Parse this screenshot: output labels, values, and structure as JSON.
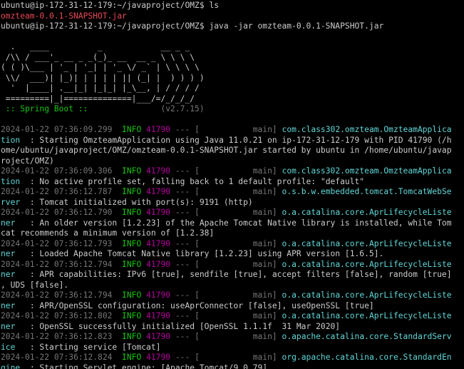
{
  "terminal": {
    "lines": [
      [
        {
          "t": "ubuntu@ip-172-31-12-179:~/javaproject/OMZ$ ls",
          "c": "white"
        }
      ],
      [
        {
          "t": "omzteam-0.0.1-SNAPSHOT.jar",
          "c": "red"
        }
      ],
      [
        {
          "t": "ubuntu@ip-172-31-12-179:~/javaproject/OMZ$ java -jar omzteam-0.0.1-SNAPSHOT.jar",
          "c": "white"
        }
      ],
      [
        {
          "t": "",
          "c": "white"
        }
      ],
      [
        {
          "t": "  .   ____          _            __ _ _",
          "c": "white"
        }
      ],
      [
        {
          "t": " /\\\\ / ___'_ __ _ _(_)_ __  __ _ \\ \\ \\ \\",
          "c": "white"
        }
      ],
      [
        {
          "t": "( ( )\\___ | '_ | '_| | '_ \\/ _` | \\ \\ \\ \\",
          "c": "white"
        }
      ],
      [
        {
          "t": " \\\\/  ___)| |_)| | | | | || (_| |  ) ) ) )",
          "c": "white"
        }
      ],
      [
        {
          "t": "  '  |____| .__|_| |_|_| |_\\__, | / / / /",
          "c": "white"
        }
      ],
      [
        {
          "t": " =========|_|==============|___/=/_/_/_/",
          "c": "white"
        }
      ],
      [
        {
          "t": " :: Spring Boot :: ",
          "c": "green"
        },
        {
          "t": "              (v2.7.15)",
          "c": "gray"
        }
      ],
      [
        {
          "t": "",
          "c": "white"
        }
      ],
      [
        {
          "t": "2024-01-22 07:36:09.299  ",
          "c": "gray"
        },
        {
          "t": "INFO ",
          "c": "green"
        },
        {
          "t": "41790",
          "c": "magenta"
        },
        {
          "t": " --- [           main] ",
          "c": "gray"
        },
        {
          "t": "com.class302.omzteam.OmzteamApplica",
          "c": "cyan"
        }
      ],
      [
        {
          "t": "tion  ",
          "c": "cyan"
        },
        {
          "t": ": Starting OmzteamApplication using Java 11.0.21 on ip-172-31-12-179 with PID 41790 (/h",
          "c": "white"
        }
      ],
      [
        {
          "t": "ome/ubuntu/javaproject/OMZ/omzteam-0.0.1-SNAPSHOT.jar started by ubuntu in /home/ubuntu/javap",
          "c": "white"
        }
      ],
      [
        {
          "t": "roject/OMZ)",
          "c": "white"
        }
      ],
      [
        {
          "t": "2024-01-22 07:36:09.306  ",
          "c": "gray"
        },
        {
          "t": "INFO ",
          "c": "green"
        },
        {
          "t": "41790",
          "c": "magenta"
        },
        {
          "t": " --- [           main] ",
          "c": "gray"
        },
        {
          "t": "com.class302.omzteam.OmzteamApplica",
          "c": "cyan"
        }
      ],
      [
        {
          "t": "tion  ",
          "c": "cyan"
        },
        {
          "t": ": No active profile set, falling back to 1 default profile: \"default\"",
          "c": "white"
        }
      ],
      [
        {
          "t": "2024-01-22 07:36:12.787  ",
          "c": "gray"
        },
        {
          "t": "INFO ",
          "c": "green"
        },
        {
          "t": "41790",
          "c": "magenta"
        },
        {
          "t": " --- [           main] ",
          "c": "gray"
        },
        {
          "t": "o.s.b.w.embedded.tomcat.TomcatWebSe",
          "c": "cyan"
        }
      ],
      [
        {
          "t": "rver  ",
          "c": "cyan"
        },
        {
          "t": ": Tomcat initialized with port(s): 9191 (http)",
          "c": "white"
        }
      ],
      [
        {
          "t": "2024-01-22 07:36:12.790  ",
          "c": "gray"
        },
        {
          "t": "INFO ",
          "c": "green"
        },
        {
          "t": "41790",
          "c": "magenta"
        },
        {
          "t": " --- [           main] ",
          "c": "gray"
        },
        {
          "t": "o.a.catalina.core.AprLifecycleListe",
          "c": "cyan"
        }
      ],
      [
        {
          "t": "ner   ",
          "c": "cyan"
        },
        {
          "t": ": An older version [1.2.23] of the Apache Tomcat Native library is installed, while Tom",
          "c": "white"
        }
      ],
      [
        {
          "t": "cat recommends a minimum version of [1.2.38]",
          "c": "white"
        }
      ],
      [
        {
          "t": "2024-01-22 07:36:12.793  ",
          "c": "gray"
        },
        {
          "t": "INFO ",
          "c": "green"
        },
        {
          "t": "41790",
          "c": "magenta"
        },
        {
          "t": " --- [           main] ",
          "c": "gray"
        },
        {
          "t": "o.a.catalina.core.AprLifecycleListe",
          "c": "cyan"
        }
      ],
      [
        {
          "t": "ner   ",
          "c": "cyan"
        },
        {
          "t": ": Loaded Apache Tomcat Native library [1.2.23] using APR version [1.6.5].",
          "c": "white"
        }
      ],
      [
        {
          "t": "2024-01-22 07:36:12.794  ",
          "c": "gray"
        },
        {
          "t": "INFO ",
          "c": "green"
        },
        {
          "t": "41790",
          "c": "magenta"
        },
        {
          "t": " --- [           main] ",
          "c": "gray"
        },
        {
          "t": "o.a.catalina.core.AprLifecycleListe",
          "c": "cyan"
        }
      ],
      [
        {
          "t": "ner   ",
          "c": "cyan"
        },
        {
          "t": ": APR capabilities: IPv6 [true], sendfile [true], accept filters [false], random [true]",
          "c": "white"
        }
      ],
      [
        {
          "t": ", UDS [false].",
          "c": "white"
        }
      ],
      [
        {
          "t": "2024-01-22 07:36:12.794  ",
          "c": "gray"
        },
        {
          "t": "INFO ",
          "c": "green"
        },
        {
          "t": "41790",
          "c": "magenta"
        },
        {
          "t": " --- [           main] ",
          "c": "gray"
        },
        {
          "t": "o.a.catalina.core.AprLifecycleListe",
          "c": "cyan"
        }
      ],
      [
        {
          "t": "ner   ",
          "c": "cyan"
        },
        {
          "t": ": APR/OpenSSL configuration: useAprConnector [false], useOpenSSL [true]",
          "c": "white"
        }
      ],
      [
        {
          "t": "2024-01-22 07:36:12.802  ",
          "c": "gray"
        },
        {
          "t": "INFO ",
          "c": "green"
        },
        {
          "t": "41790",
          "c": "magenta"
        },
        {
          "t": " --- [           main] ",
          "c": "gray"
        },
        {
          "t": "o.a.catalina.core.AprLifecycleListe",
          "c": "cyan"
        }
      ],
      [
        {
          "t": "ner   ",
          "c": "cyan"
        },
        {
          "t": ": OpenSSL successfully initialized [OpenSSL 1.1.1f  31 Mar 2020]",
          "c": "white"
        }
      ],
      [
        {
          "t": "2024-01-22 07:36:12.823  ",
          "c": "gray"
        },
        {
          "t": "INFO ",
          "c": "green"
        },
        {
          "t": "41790",
          "c": "magenta"
        },
        {
          "t": " --- [           main] ",
          "c": "gray"
        },
        {
          "t": "o.apache.catalina.core.StandardServ",
          "c": "cyan"
        }
      ],
      [
        {
          "t": "ice   ",
          "c": "cyan"
        },
        {
          "t": ": Starting service [Tomcat]",
          "c": "white"
        }
      ],
      [
        {
          "t": "2024-01-22 07:36:12.824  ",
          "c": "gray"
        },
        {
          "t": "INFO ",
          "c": "green"
        },
        {
          "t": "41790",
          "c": "magenta"
        },
        {
          "t": " --- [           main] ",
          "c": "gray"
        },
        {
          "t": "org.apache.catalina.core.StandardEn",
          "c": "cyan"
        }
      ],
      [
        {
          "t": "gine  ",
          "c": "cyan"
        },
        {
          "t": ": Starting Servlet engine: [Apache Tomcat/9.0.79]",
          "c": "white"
        }
      ],
      [
        {
          "t": "2024-01-22 07:36:13.046  ",
          "c": "gray"
        },
        {
          "t": "INFO ",
          "c": "green"
        },
        {
          "t": "41790",
          "c": "magenta"
        },
        {
          "t": " --- [           main] ",
          "c": "gray"
        },
        {
          "t": "o.a.c.c.C.[Tomcat].[localhost].[/]",
          "c": "cyan"
        }
      ]
    ]
  },
  "colors": {
    "background": "#000000",
    "text": "#cccccc",
    "red": "#e74856",
    "green": "#16c60c",
    "cyan": "#61d6d6",
    "magenta": "#b4009e",
    "gray": "#767676"
  }
}
